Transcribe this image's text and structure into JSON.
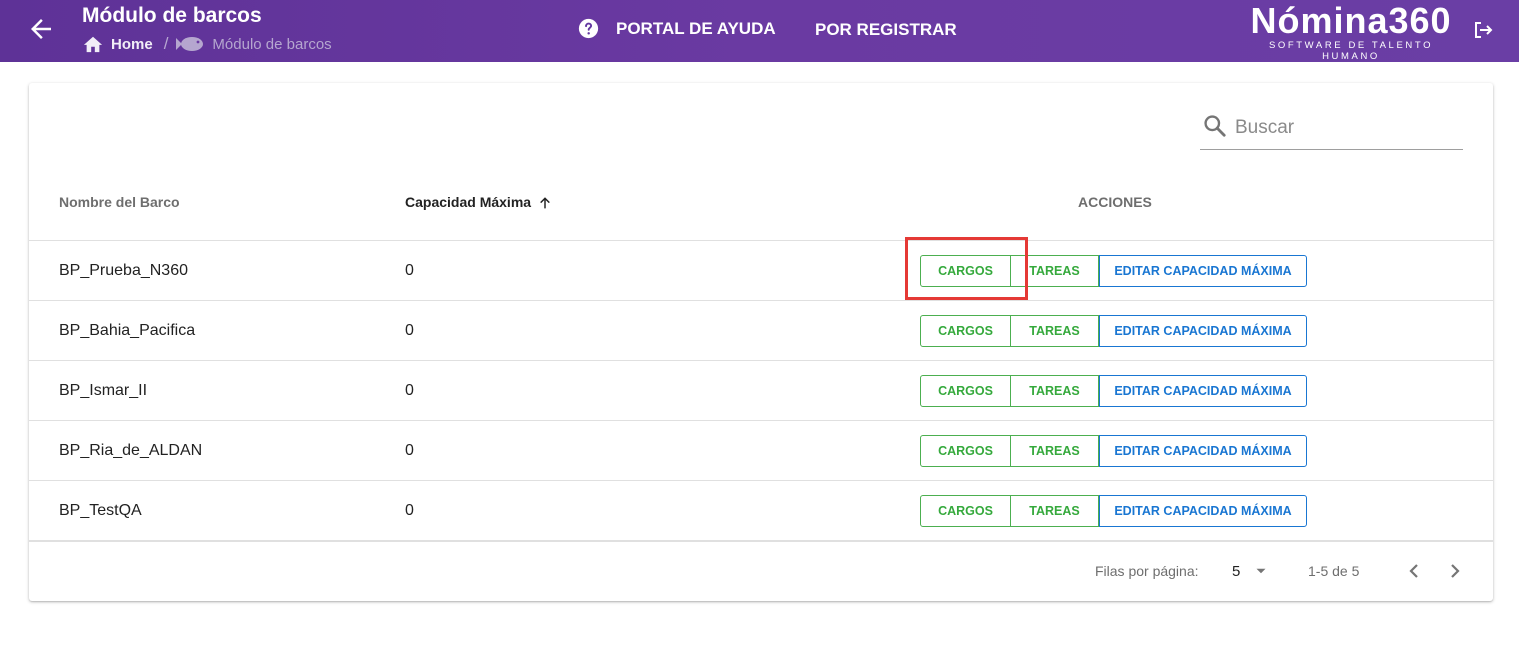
{
  "header": {
    "title": "Módulo de barcos",
    "breadcrumb": {
      "home": "Home",
      "current": "Módulo de barcos"
    },
    "help_label": "PORTAL DE AYUDA",
    "register_label": "POR REGISTRAR",
    "logo": {
      "name": "Nómina360",
      "tagline": "SOFTWARE DE TALENTO HUMANO"
    }
  },
  "search": {
    "placeholder": "Buscar"
  },
  "table": {
    "columns": {
      "name": "Nombre del Barco",
      "capacity": "Capacidad Máxima",
      "actions": "ACCIONES"
    },
    "action_labels": {
      "cargos": "CARGOS",
      "tareas": "TAREAS",
      "editar": "EDITAR CAPACIDAD MÁXIMA"
    },
    "rows": [
      {
        "name": "BP_Prueba_N360",
        "capacity": "0"
      },
      {
        "name": "BP_Bahia_Pacifica",
        "capacity": "0"
      },
      {
        "name": "BP_Ismar_II",
        "capacity": "0"
      },
      {
        "name": "BP_Ria_de_ALDAN",
        "capacity": "0"
      },
      {
        "name": "BP_TestQA",
        "capacity": "0"
      }
    ]
  },
  "pagination": {
    "rows_per_page_label": "Filas por página:",
    "rows_per_page": "5",
    "range": "1-5 de 5"
  },
  "colors": {
    "header_purple": "#5e3297",
    "green": "#4caf50",
    "blue": "#1976d2",
    "highlight_red": "#e53935"
  },
  "icons": [
    "arrow-left-icon",
    "home-icon",
    "fish-icon",
    "help-circle-icon",
    "logout-icon",
    "search-icon",
    "sort-arrow-up-icon",
    "dropdown-caret-icon",
    "chevron-left-icon",
    "chevron-right-icon"
  ]
}
